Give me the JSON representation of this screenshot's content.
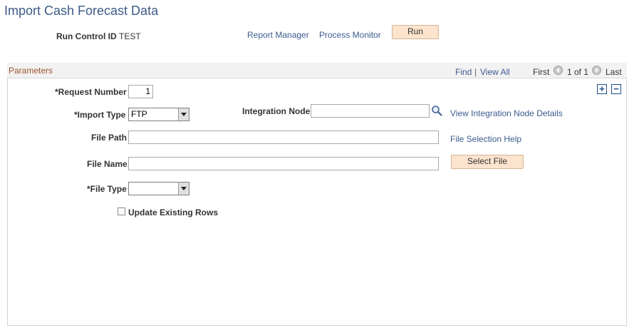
{
  "page": {
    "title": "Import Cash Forecast Data"
  },
  "header": {
    "run_control_label": "Run Control ID",
    "run_control_value": "TEST",
    "report_manager_link": "Report Manager",
    "process_monitor_link": "Process Monitor",
    "run_button": "Run"
  },
  "panel": {
    "title": "Parameters",
    "find_link": "Find",
    "separator": "|",
    "view_all_link": "View All",
    "first_label": "First",
    "count": "1 of 1",
    "last_label": "Last"
  },
  "form": {
    "request_number_label": "*Request Number",
    "request_number_value": "1",
    "import_type_label": "*Import Type",
    "import_type_value": "FTP",
    "integration_node_label": "Integration Node",
    "integration_node_value": "",
    "view_node_details_link": "View Integration Node Details",
    "file_path_label": "File Path",
    "file_path_value": "",
    "file_selection_help_link": "File Selection Help",
    "file_name_label": "File Name",
    "file_name_value": "",
    "select_file_button": "Select File",
    "file_type_label": "*File Type",
    "file_type_value": "",
    "update_existing_rows_label": "Update Existing Rows",
    "update_existing_rows_checked": false
  },
  "icons": {
    "lookup": "magnifier-icon",
    "add_row": "plus-icon",
    "delete_row": "minus-icon",
    "previous": "arrow-left-icon",
    "next": "arrow-right-icon"
  }
}
